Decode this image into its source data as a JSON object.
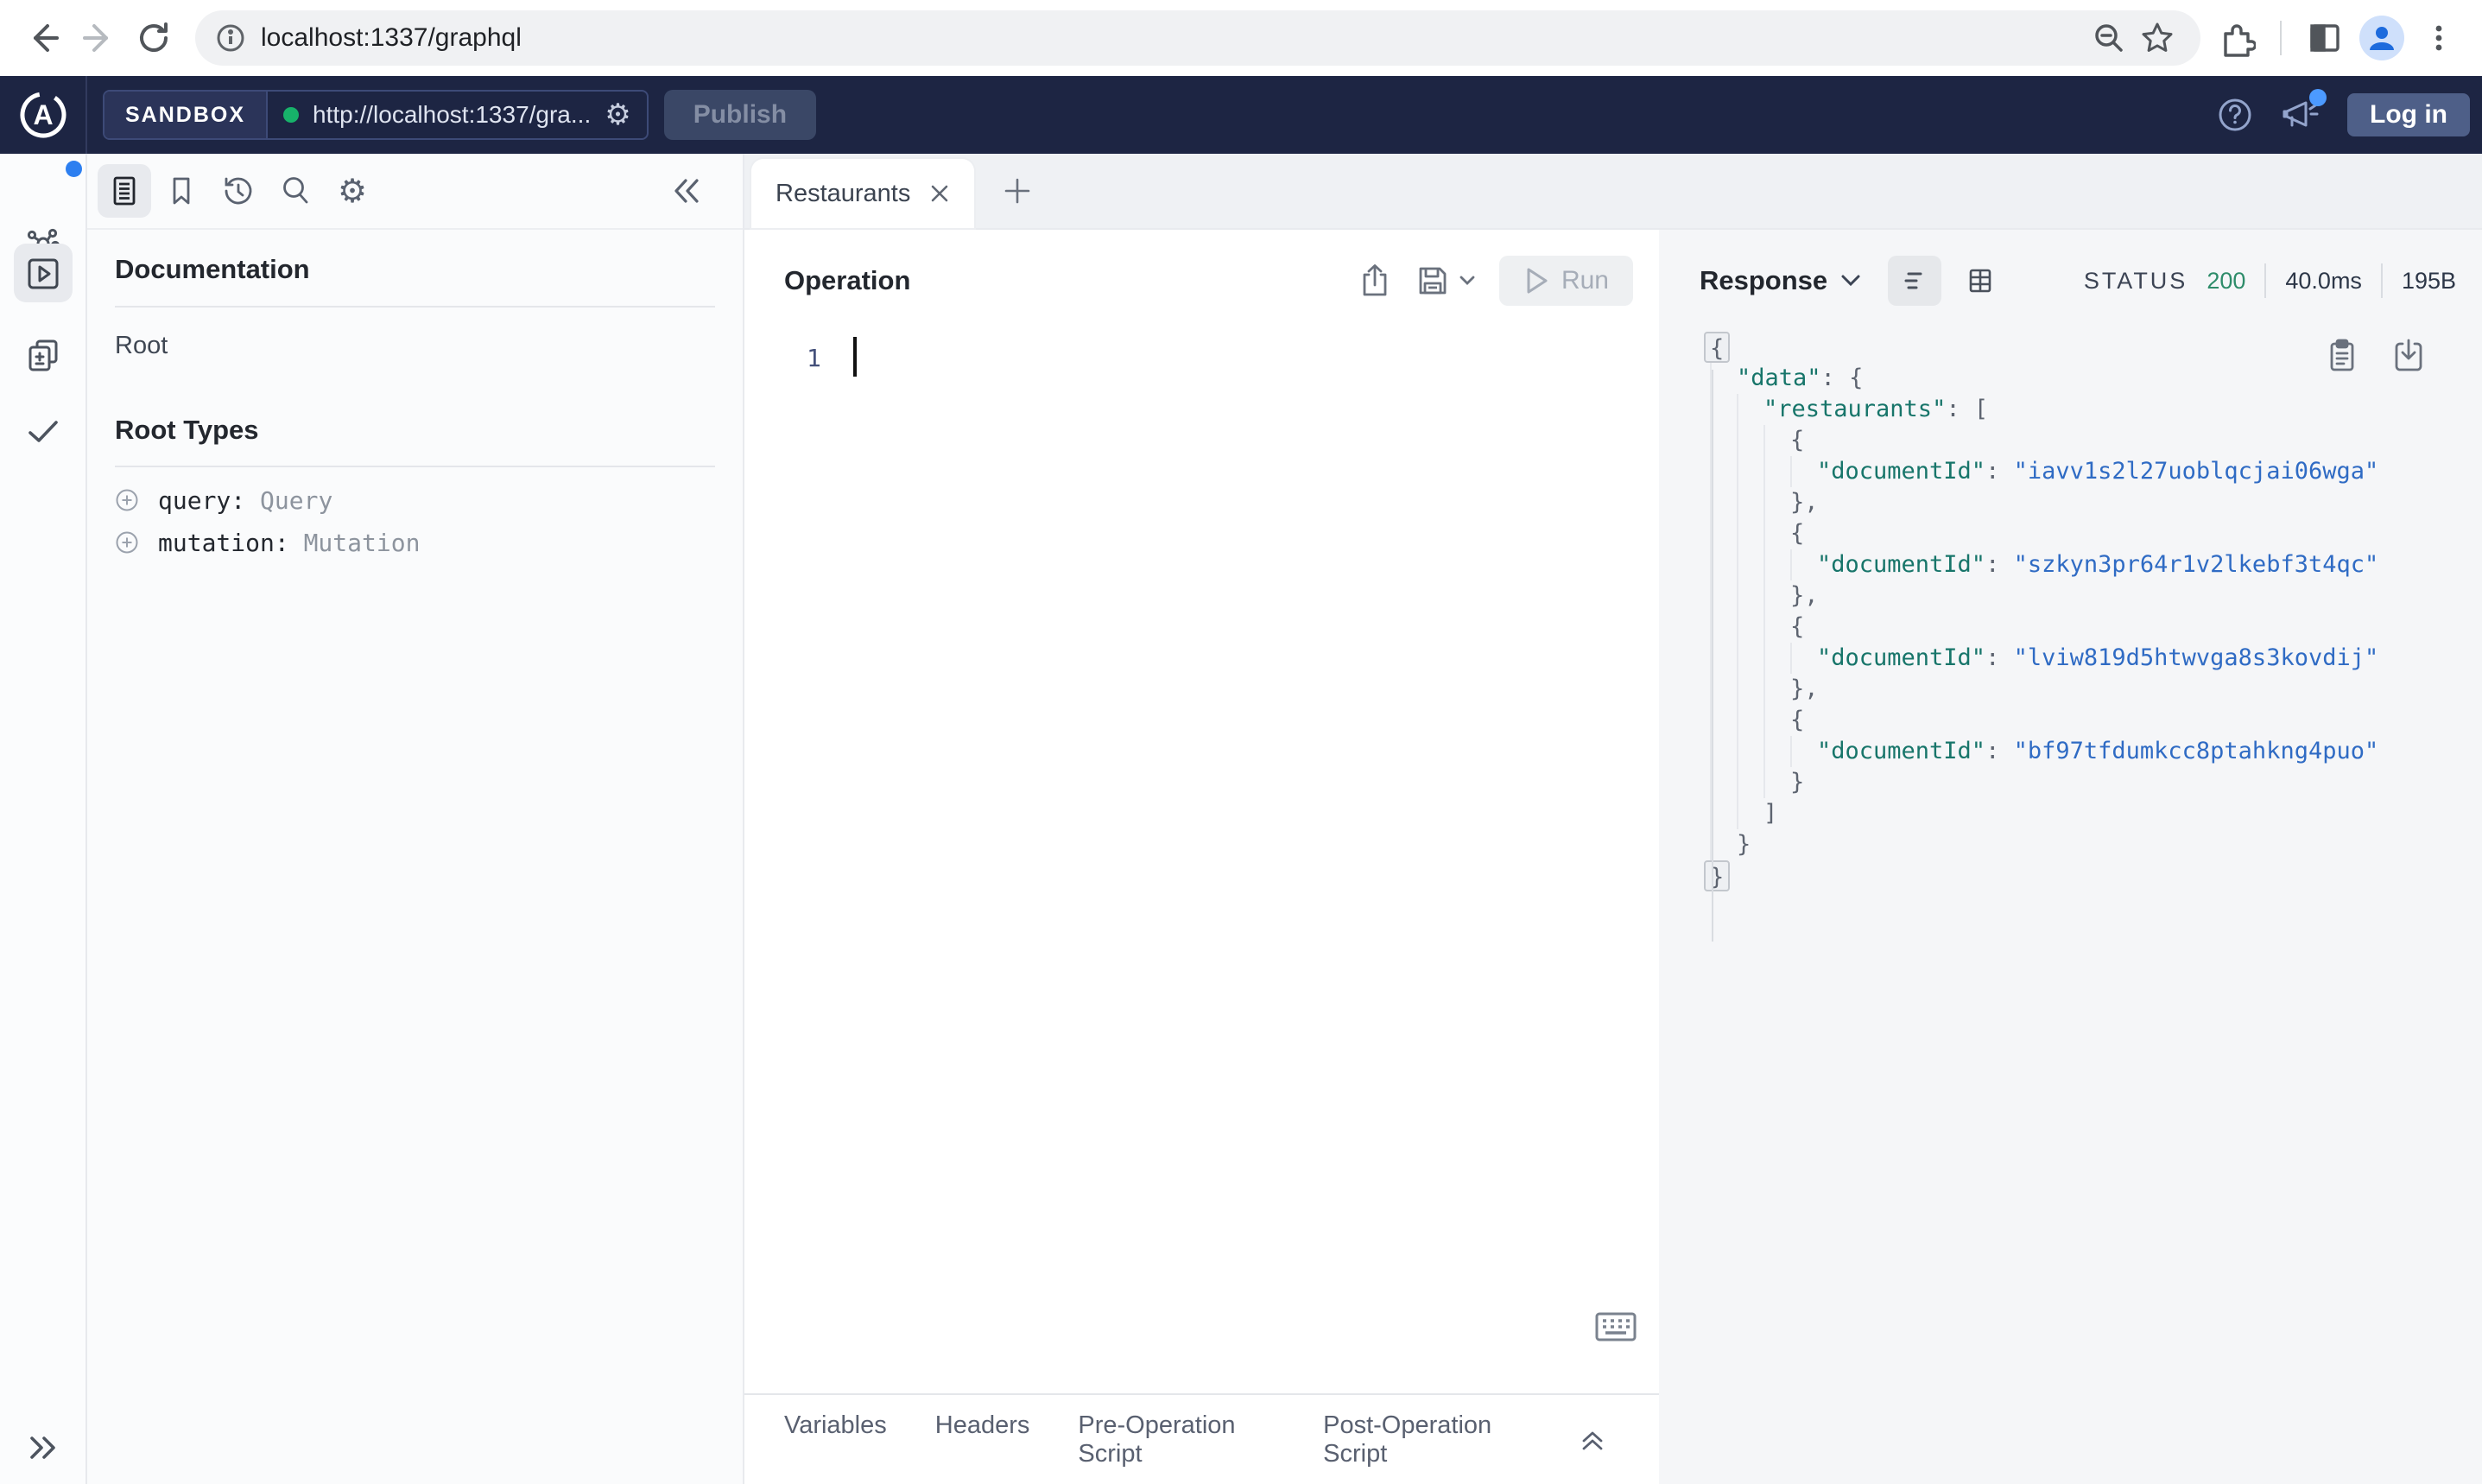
{
  "browser": {
    "url": "localhost:1337/graphql"
  },
  "header": {
    "brand_letter": "A",
    "env_label": "SANDBOX",
    "endpoint": "http://localhost:1337/gra...",
    "publish_label": "Publish",
    "login_label": "Log in"
  },
  "docs": {
    "title": "Documentation",
    "root_item": "Root",
    "section_title": "Root Types",
    "root_types": [
      {
        "name": "query",
        "type": "Query"
      },
      {
        "name": "mutation",
        "type": "Mutation"
      }
    ]
  },
  "tabs": {
    "active_label": "Restaurants"
  },
  "operation": {
    "title": "Operation",
    "run_label": "Run",
    "line_number": "1",
    "footer_tabs": [
      "Variables",
      "Headers",
      "Pre-Operation Script",
      "Post-Operation Script"
    ]
  },
  "response": {
    "title": "Response",
    "status_label": "STATUS",
    "status_code": "200",
    "time": "40.0ms",
    "size": "195B",
    "document_ids": [
      "iavv1s2l27uoblqcjai06wga",
      "szkyn3pr64r1v2lkebf3t4qc",
      "lviw819d5htwvga8s3kovdij",
      "bf97tfdumkcc8ptahkng4puo"
    ],
    "json_lines": [
      {
        "i": 0,
        "s": [
          {
            "t": "{",
            "c": "p",
            "f": 1
          }
        ]
      },
      {
        "i": 1,
        "s": [
          {
            "t": "\"data\"",
            "c": "k"
          },
          {
            "t": ": ",
            "c": "p"
          },
          {
            "t": "{",
            "c": "p"
          }
        ]
      },
      {
        "i": 2,
        "s": [
          {
            "t": "\"restaurants\"",
            "c": "k"
          },
          {
            "t": ": ",
            "c": "p"
          },
          {
            "t": "[",
            "c": "p"
          }
        ]
      },
      {
        "i": 3,
        "s": [
          {
            "t": "{",
            "c": "p"
          }
        ]
      },
      {
        "i": 4,
        "s": [
          {
            "t": "\"documentId\"",
            "c": "k"
          },
          {
            "t": ": ",
            "c": "p"
          },
          {
            "t": "\"iavv1s2l27uoblqcjai06wga\"",
            "c": "str"
          }
        ]
      },
      {
        "i": 3,
        "s": [
          {
            "t": "},",
            "c": "p"
          }
        ]
      },
      {
        "i": 3,
        "s": [
          {
            "t": "{",
            "c": "p"
          }
        ]
      },
      {
        "i": 4,
        "s": [
          {
            "t": "\"documentId\"",
            "c": "k"
          },
          {
            "t": ": ",
            "c": "p"
          },
          {
            "t": "\"szkyn3pr64r1v2lkebf3t4qc\"",
            "c": "str"
          }
        ]
      },
      {
        "i": 3,
        "s": [
          {
            "t": "},",
            "c": "p"
          }
        ]
      },
      {
        "i": 3,
        "s": [
          {
            "t": "{",
            "c": "p"
          }
        ]
      },
      {
        "i": 4,
        "s": [
          {
            "t": "\"documentId\"",
            "c": "k"
          },
          {
            "t": ": ",
            "c": "p"
          },
          {
            "t": "\"lviw819d5htwvga8s3kovdij\"",
            "c": "str"
          }
        ]
      },
      {
        "i": 3,
        "s": [
          {
            "t": "},",
            "c": "p"
          }
        ]
      },
      {
        "i": 3,
        "s": [
          {
            "t": "{",
            "c": "p"
          }
        ]
      },
      {
        "i": 4,
        "s": [
          {
            "t": "\"documentId\"",
            "c": "k"
          },
          {
            "t": ": ",
            "c": "p"
          },
          {
            "t": "\"bf97tfdumkcc8ptahkng4puo\"",
            "c": "str"
          }
        ]
      },
      {
        "i": 3,
        "s": [
          {
            "t": "}",
            "c": "p"
          }
        ]
      },
      {
        "i": 2,
        "s": [
          {
            "t": "]",
            "c": "p"
          }
        ]
      },
      {
        "i": 1,
        "s": [
          {
            "t": "}",
            "c": "p"
          }
        ]
      },
      {
        "i": 0,
        "s": [
          {
            "t": "}",
            "c": "p",
            "f": 1
          }
        ]
      }
    ]
  },
  "colors": {
    "header_navy": "#1d2543",
    "connected_green": "#17b26a",
    "status_green": "#2e8c6a",
    "json_key_teal": "#17756a",
    "json_string_blue": "#2f6bc4",
    "notification_blue": "#4c9aff",
    "login_button": "#4e5f88"
  }
}
